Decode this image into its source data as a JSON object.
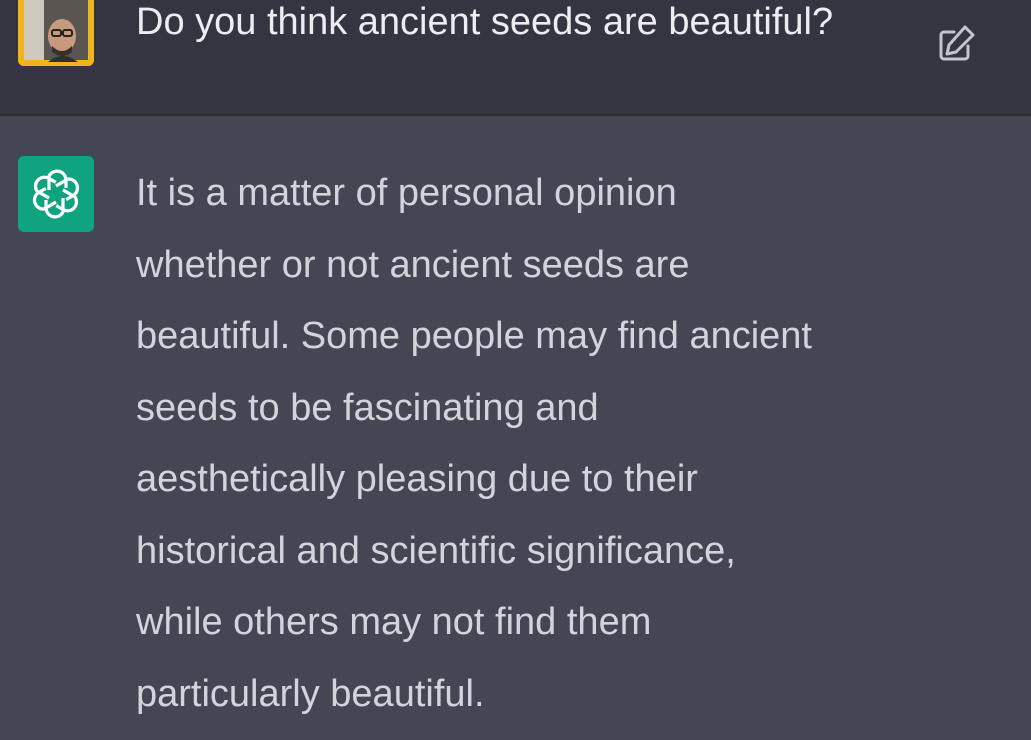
{
  "conversation": {
    "user_message": {
      "avatar_icon": "user-photo-avatar",
      "avatar_color": "#f0b41c",
      "text": "Do you think ancient seeds are beautiful?",
      "edit_icon": "edit-icon"
    },
    "assistant_message": {
      "avatar_icon": "openai-logo-icon",
      "avatar_color": "#10a37f",
      "text": "It is a matter of personal opinion whether or not ancient seeds are beautiful. Some people may find ancient seeds to be fascinating and aesthetically pleasing due to their historical and scientific significance, while others may not find them particularly beautiful."
    }
  },
  "colors": {
    "user_background": "#343541",
    "assistant_background": "#444654",
    "text_primary": "#ececf1",
    "text_secondary": "#d1d5db"
  }
}
